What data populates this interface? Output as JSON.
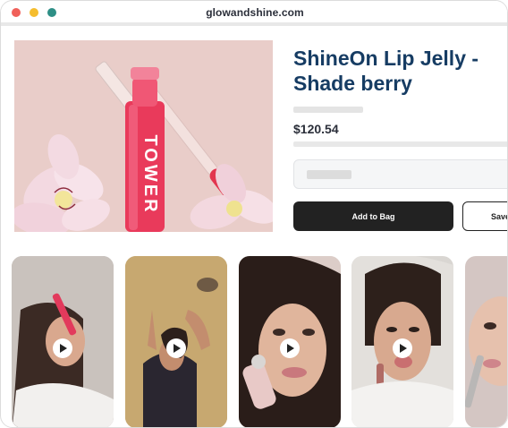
{
  "browser": {
    "url": "glowandshine.com"
  },
  "product": {
    "title_line1": "ShineOn Lip Jelly -",
    "title_line2": "Shade berry",
    "price": "$120.54",
    "tube_brand": "TOWER",
    "add_to_bag_label": "Add to Bag",
    "save_label": "Save"
  },
  "videos": [
    {
      "name": "video-1",
      "icon": "play-icon"
    },
    {
      "name": "video-2",
      "icon": "play-icon"
    },
    {
      "name": "video-3",
      "icon": "play-icon"
    },
    {
      "name": "video-4",
      "icon": "play-icon"
    },
    {
      "name": "video-5",
      "icon": "play-icon"
    }
  ],
  "colors": {
    "title": "#163c63",
    "button_dark": "#222222",
    "lip_gloss": "#e23a5c"
  }
}
